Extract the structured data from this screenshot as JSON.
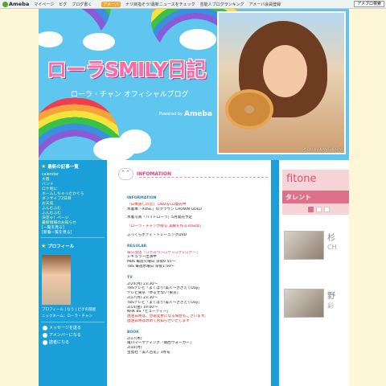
{
  "topbar": {
    "logo": "Ameba",
    "links": [
      "マイページ",
      "ピグ",
      "ブログ書く"
    ],
    "promo": "アメーバ",
    "news": "ナリ目指そう!最新ニュースをチェック",
    "ranking": "芸能人ブログランキング",
    "pig": "アメーバ会員登録",
    "button": "アメブロ検索"
  },
  "header": {
    "title": "ローラSMILY日記",
    "subtitle": "ローラ・チャン オフィシャルブログ",
    "powered_label": "Powered by",
    "powered_brand": "Ameba",
    "photo_credit": "Photo by KAN FURUYA"
  },
  "sidebar": {
    "latest_heading": "最新の記事一覧",
    "latest_items": [
      "calendar",
      "大阪",
      "バンド",
      "ロケ地に",
      "ホームしちゃったかぐら",
      "ダンサイブ2日目",
      "お天気",
      "ふんむふむ",
      "ふんむふむ",
      "決定ゃ！ページ",
      "最新情報のお知らせ",
      "[一覧を見る]",
      "[新着一覧を見る]"
    ],
    "profile_heading": "プロフィール",
    "profile_links": "プロフィール | なう | ピグの部屋",
    "nickname": "ニックネーム：ローラ・チャン",
    "rows": [
      "メッセージを送る",
      "アメンバーになる",
      "読者になる"
    ]
  },
  "main": {
    "title": "INFOMATION",
    "info_heading": "INFORMATION",
    "info_lines": [
      {
        "text": "「日本語しの恋」 DVD＆CD発売中",
        "cls": "red"
      },
      {
        "text": "水着本「ROSE」のクラウン CROWN GOLD",
        "cls": ""
      },
      {
        "text": "水着写真「バイトローラ」5月発売予定",
        "cls": ""
      },
      {
        "text": "「ローラ・チャンが贈る 美脚を作る30日間」",
        "cls": "red"
      },
      {
        "text": "ふっくらボディ・トレーニングDVD",
        "cls": ""
      }
    ],
    "regular_heading": "REGULAR",
    "regular_lines": [
      {
        "text": "毎日放送「ロケみつ〜ロケ×ロケ×ロケ〜」",
        "cls": "pink"
      },
      {
        "text": "レギュラー出演中",
        "cls": ""
      },
      {
        "text": "MBS 毎週火曜日 深夜0:55〜",
        "cls": ""
      },
      {
        "text": "TBS 毎週水曜日 深夜1:50〜",
        "cls": ""
      }
    ],
    "tv_heading": "TV",
    "tv_lines": [
      {
        "text": "2/24(月) 23:30〜",
        "cls": ""
      },
      {
        "text": "TBSテレビ「よくばり!美人〜ささえてDay」",
        "cls": ""
      },
      {
        "text": "テレビ東京「ゆるせない!東京」",
        "cls": ""
      },
      {
        "text": "2/17(月) 23:30〜",
        "cls": ""
      },
      {
        "text": "TBSテレビ「よくばり!美人〜ささえてDay」",
        "cls": ""
      },
      {
        "text": "2/14(金) 19:00〜",
        "cls": ""
      },
      {
        "text": "NHK BS「ビューティー」",
        "cls": ""
      },
      {
        "text": "放送日時は、急遽変更になる場合もございます。",
        "cls": "red"
      },
      {
        "text": "放送日時は改めてお知らせいたします",
        "cls": "red"
      }
    ],
    "book_heading": "BOOK",
    "book_lines": [
      {
        "text": "2/17(木)",
        "cls": ""
      },
      {
        "text": "角川マーケティング「関西ウォーカー」",
        "cls": ""
      },
      {
        "text": "2/10(月)",
        "cls": ""
      },
      {
        "text": "宝島社「美人百花」3月号",
        "cls": ""
      }
    ]
  },
  "right": {
    "banner_text": "fitone",
    "banner_bar": "タレント",
    "talents": [
      {
        "name": "杉",
        "sub": "CH"
      },
      {
        "name": "野",
        "sub": "彩"
      }
    ]
  }
}
